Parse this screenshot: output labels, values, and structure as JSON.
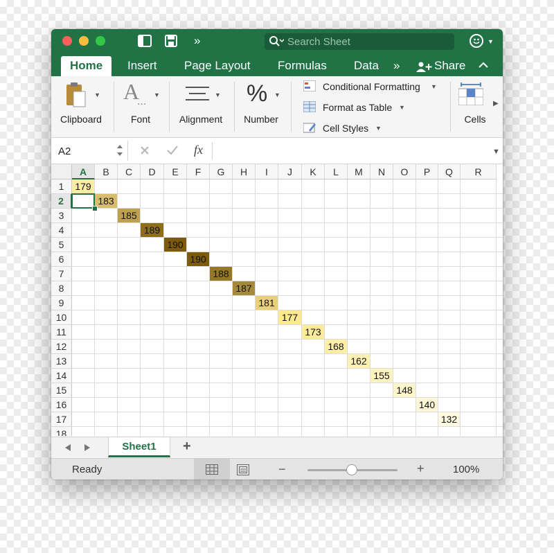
{
  "window": {
    "search_placeholder": "Search Sheet"
  },
  "tabs": {
    "home": "Home",
    "insert": "Insert",
    "page_layout": "Page Layout",
    "formulas": "Formulas",
    "data": "Data",
    "more": "»",
    "share": "Share"
  },
  "ribbon": {
    "clipboard": "Clipboard",
    "font": "Font",
    "alignment": "Alignment",
    "number": "Number",
    "number_glyph": "%",
    "conditional_formatting": "Conditional Formatting",
    "format_as_table": "Format as Table",
    "cell_styles": "Cell Styles",
    "cells": "Cells"
  },
  "formula_bar": {
    "name_box": "A2",
    "fx": "fx",
    "formula": ""
  },
  "grid": {
    "columns": [
      "A",
      "B",
      "C",
      "D",
      "E",
      "F",
      "G",
      "H",
      "I",
      "J",
      "K",
      "L",
      "M",
      "N",
      "O",
      "P",
      "Q",
      "R"
    ],
    "rows": [
      "1",
      "2",
      "3",
      "4",
      "5",
      "6",
      "7",
      "8",
      "9",
      "10",
      "11",
      "12",
      "13",
      "14",
      "15",
      "16",
      "17",
      "18"
    ],
    "selected_cell": "A2",
    "cells": [
      {
        "ref": "A1",
        "row": 1,
        "col": 0,
        "value": "179",
        "fill": "#fbeda3"
      },
      {
        "ref": "B2",
        "row": 2,
        "col": 1,
        "value": "183",
        "fill": "#d7bd6c"
      },
      {
        "ref": "C3",
        "row": 3,
        "col": 2,
        "value": "185",
        "fill": "#bfa050"
      },
      {
        "ref": "D4",
        "row": 4,
        "col": 3,
        "value": "189",
        "fill": "#8e6d1c"
      },
      {
        "ref": "E5",
        "row": 5,
        "col": 4,
        "value": "190",
        "fill": "#7d5b0c"
      },
      {
        "ref": "F6",
        "row": 6,
        "col": 5,
        "value": "190",
        "fill": "#7d5b0c"
      },
      {
        "ref": "G7",
        "row": 7,
        "col": 6,
        "value": "188",
        "fill": "#977829"
      },
      {
        "ref": "H8",
        "row": 8,
        "col": 7,
        "value": "187",
        "fill": "#a68a3c"
      },
      {
        "ref": "I9",
        "row": 9,
        "col": 8,
        "value": "181",
        "fill": "#eacf7a"
      },
      {
        "ref": "J10",
        "row": 10,
        "col": 9,
        "value": "177",
        "fill": "#fce990"
      },
      {
        "ref": "K11",
        "row": 11,
        "col": 10,
        "value": "173",
        "fill": "#fdeb9c"
      },
      {
        "ref": "L12",
        "row": 12,
        "col": 11,
        "value": "168",
        "fill": "#feeea8"
      },
      {
        "ref": "M13",
        "row": 13,
        "col": 12,
        "value": "162",
        "fill": "#fff0b4"
      },
      {
        "ref": "N14",
        "row": 14,
        "col": 13,
        "value": "155",
        "fill": "#fff3c0"
      },
      {
        "ref": "O15",
        "row": 15,
        "col": 14,
        "value": "148",
        "fill": "#fff5cb"
      },
      {
        "ref": "P16",
        "row": 16,
        "col": 15,
        "value": "140",
        "fill": "#fff7d6"
      },
      {
        "ref": "Q17",
        "row": 17,
        "col": 16,
        "value": "132",
        "fill": "#fff9e0"
      }
    ]
  },
  "sheets": {
    "active": "Sheet1",
    "add": "+"
  },
  "status": {
    "ready": "Ready",
    "zoom_minus": "−",
    "zoom_plus": "+",
    "zoom": "100%",
    "zoom_level": 1.0
  },
  "colors": {
    "accent": "#217346"
  }
}
